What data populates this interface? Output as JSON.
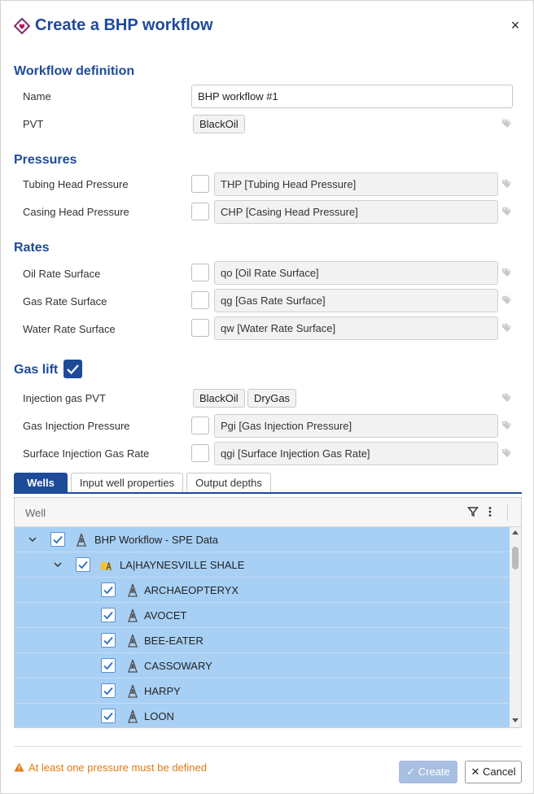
{
  "dialog": {
    "title": "Create a BHP workflow",
    "close_symbol": "×"
  },
  "workflow_definition": {
    "title": "Workflow definition",
    "name_label": "Name",
    "name_value": "BHP workflow #1",
    "pvt_label": "PVT",
    "pvt_value": "BlackOil"
  },
  "pressures": {
    "title": "Pressures",
    "items": [
      {
        "label": "Tubing Head Pressure",
        "value": "THP [Tubing Head Pressure]",
        "checked": false
      },
      {
        "label": "Casing Head Pressure",
        "value": "CHP [Casing Head Pressure]",
        "checked": false
      }
    ]
  },
  "rates": {
    "title": "Rates",
    "items": [
      {
        "label": "Oil Rate Surface",
        "value": "qo [Oil Rate Surface]",
        "checked": false
      },
      {
        "label": "Gas Rate Surface",
        "value": "qg [Gas Rate Surface]",
        "checked": false
      },
      {
        "label": "Water Rate Surface",
        "value": "qw [Water Rate Surface]",
        "checked": false
      }
    ]
  },
  "gas_lift": {
    "title": "Gas lift",
    "enabled": true,
    "injection_pvt_label": "Injection gas PVT",
    "injection_pvt_values": [
      "BlackOil",
      "DryGas"
    ],
    "items": [
      {
        "label": "Gas Injection Pressure",
        "value": "Pgi [Gas Injection Pressure]",
        "checked": false
      },
      {
        "label": "Surface Injection Gas Rate",
        "value": "qgi [Surface Injection Gas Rate]",
        "checked": false
      }
    ]
  },
  "tabs": [
    "Wells",
    "Input well properties",
    "Output depths"
  ],
  "active_tab": "Wells",
  "grid": {
    "column": "Well",
    "rows": [
      {
        "label": "BHP Workflow - SPE Data",
        "level": 0,
        "type": "root",
        "expanded": true,
        "checked": true
      },
      {
        "label": "LA|HAYNESVILLE SHALE",
        "level": 1,
        "type": "folder",
        "expanded": true,
        "checked": true
      },
      {
        "label": "ARCHAEOPTERYX",
        "level": 2,
        "type": "well",
        "checked": true
      },
      {
        "label": "AVOCET",
        "level": 2,
        "type": "well",
        "checked": true
      },
      {
        "label": "BEE-EATER",
        "level": 2,
        "type": "well",
        "checked": true
      },
      {
        "label": "CASSOWARY",
        "level": 2,
        "type": "well",
        "checked": true
      },
      {
        "label": "HARPY",
        "level": 2,
        "type": "well",
        "checked": true
      },
      {
        "label": "LOON",
        "level": 2,
        "type": "well",
        "checked": true
      }
    ]
  },
  "footer": {
    "warning": "At least one pressure must be defined",
    "create_label": "Create",
    "cancel_label": "Cancel",
    "check_symbol": "✓",
    "cancel_symbol": "✕"
  },
  "colors": {
    "accent": "#1e4b99",
    "selection": "#a8d0f5",
    "warning": "#e07a10"
  }
}
